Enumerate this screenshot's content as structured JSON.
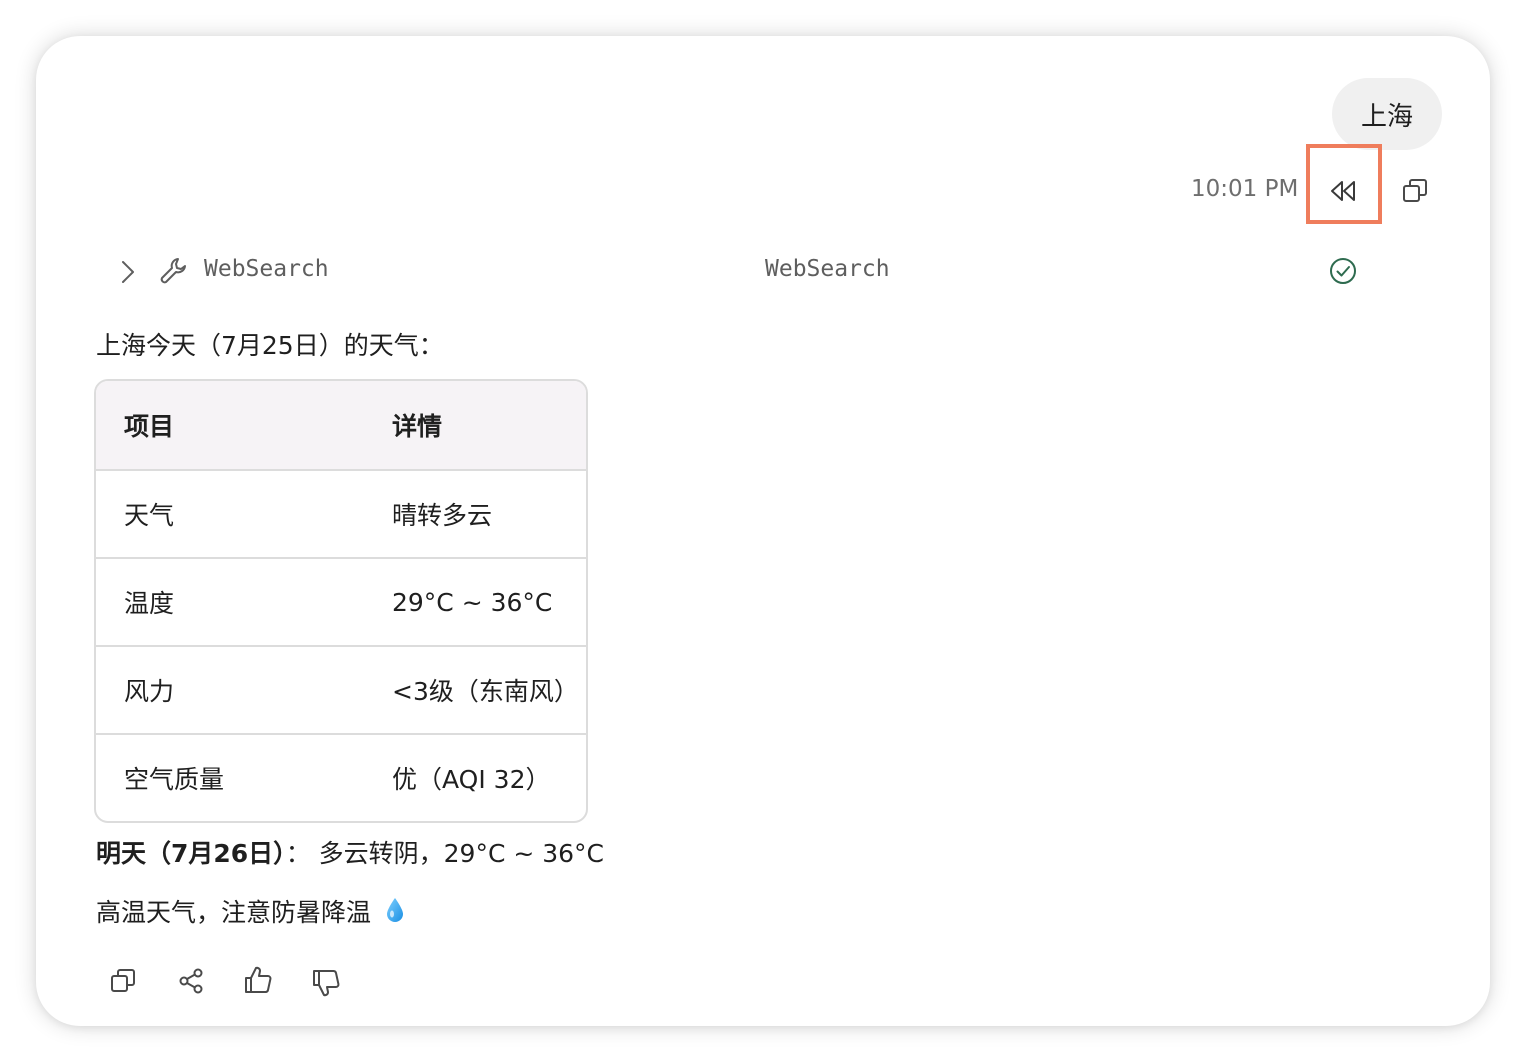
{
  "user_message": {
    "text": "上海",
    "time": "10:01 PM"
  },
  "tool_call": {
    "name": "WebSearch",
    "result_label": "WebSearch"
  },
  "answer": {
    "intro": "上海今天（7月25日）的天气：",
    "table": {
      "headers": [
        "项目",
        "详情"
      ],
      "rows": [
        [
          "天气",
          "晴转多云"
        ],
        [
          "温度",
          "29°C ~ 36°C"
        ],
        [
          "风力",
          "<3级（东南风）"
        ],
        [
          "空气质量",
          "优（AQI 32）"
        ]
      ]
    },
    "tomorrow_label": "明天（7月26日）",
    "tomorrow_text": "： 多云转阴，29°C ~ 36°C",
    "tip": "高温天气，注意防暑降温"
  },
  "colors": {
    "highlight": "#ef7d5c",
    "success": "#2e6b4f",
    "table_header_bg": "#f6f3f6"
  },
  "icons": [
    "rewind-icon",
    "copy-icon",
    "chevron-right-icon",
    "wrench-icon",
    "check-circle-icon",
    "water-drop-icon",
    "share-icon",
    "thumbs-up-icon",
    "thumbs-down-icon"
  ]
}
